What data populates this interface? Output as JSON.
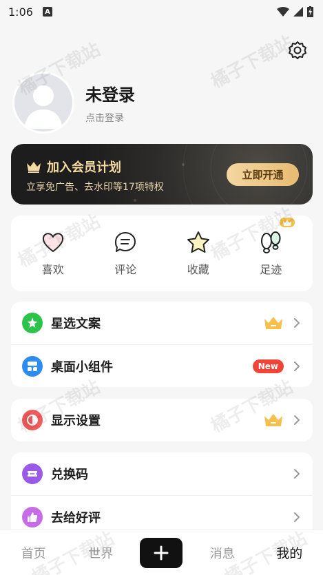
{
  "status": {
    "time": "1:06"
  },
  "profile": {
    "name": "未登录",
    "subtitle": "点击登录"
  },
  "vip": {
    "title": "加入会员计划",
    "subtitle": "立享免广告、去水印等17项特权",
    "button": "立即开通"
  },
  "quick": [
    {
      "label": "喜欢",
      "icon": "heart-icon"
    },
    {
      "label": "评论",
      "icon": "comment-icon"
    },
    {
      "label": "收藏",
      "icon": "star-icon"
    },
    {
      "label": "足迹",
      "icon": "footprint-icon"
    }
  ],
  "menu": {
    "xingxuan": "星选文案",
    "widget": "桌面小组件",
    "widget_badge": "New",
    "display": "显示设置",
    "redeem": "兑换码",
    "review": "去给好评"
  },
  "tabs": {
    "home": "首页",
    "world": "世界",
    "messages": "消息",
    "mine": "我的"
  },
  "watermark": "橘子下载站",
  "colors": {
    "accent_gold": "#e7bb72",
    "new_badge": "#f04438",
    "green": "#2bc34a",
    "blue": "#2d8cf0",
    "red": "#f25b5b",
    "purple": "#9b59e8"
  }
}
